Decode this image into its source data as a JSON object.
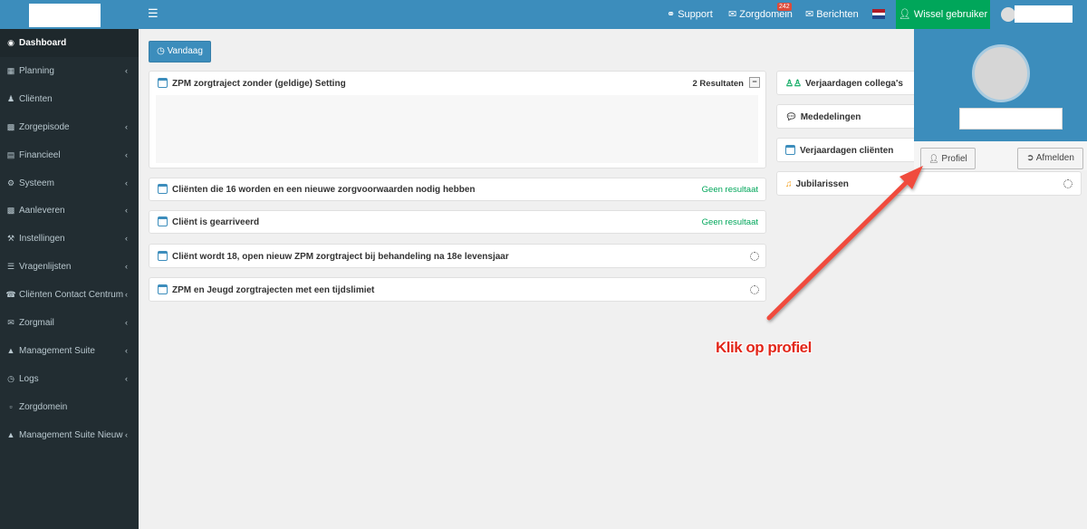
{
  "header": {
    "menu_icon": "hamburger-icon",
    "support": "Support",
    "zorgdomein": "Zorgdomein",
    "zorgdomein_badge": "242",
    "berichten": "Berichten",
    "switch_user": "Wissel gebruiker",
    "flag_colors": [
      "#ae1c28",
      "#ffffff",
      "#21468b"
    ],
    "accent": "#3c8dbc",
    "switch_color": "#00a65a"
  },
  "sidebar": {
    "items": [
      {
        "label": "Dashboard",
        "icon": "dashboard-icon",
        "chevron": false
      },
      {
        "label": "Planning",
        "icon": "calendar-icon",
        "chevron": true
      },
      {
        "label": "Cliënten",
        "icon": "user-icon",
        "chevron": false
      },
      {
        "label": "Zorgepisode",
        "icon": "medkit-icon",
        "chevron": true
      },
      {
        "label": "Financieel",
        "icon": "money-icon",
        "chevron": true
      },
      {
        "label": "Systeem",
        "icon": "cogs-icon",
        "chevron": true
      },
      {
        "label": "Aanleveren",
        "icon": "truck-icon",
        "chevron": true
      },
      {
        "label": "Instellingen",
        "icon": "wrench-icon",
        "chevron": true
      },
      {
        "label": "Vragenlijsten",
        "icon": "file-icon",
        "chevron": true
      },
      {
        "label": "Cliënten Contact Centrum",
        "icon": "phone-icon",
        "chevron": true
      },
      {
        "label": "Zorgmail",
        "icon": "envelope-icon",
        "chevron": true
      },
      {
        "label": "Management Suite",
        "icon": "chart-icon",
        "chevron": true
      },
      {
        "label": "Logs",
        "icon": "history-icon",
        "chevron": true
      },
      {
        "label": "Zorgdomein",
        "icon": "inbox-icon",
        "chevron": false
      },
      {
        "label": "Management Suite Nieuw",
        "icon": "chart-icon",
        "chevron": true
      }
    ]
  },
  "main": {
    "today_button": "Vandaag",
    "widgets_left": [
      {
        "title": "ZPM zorgtraject zonder (geldige) Setting",
        "meta": "2 Resultaten",
        "state": "results"
      },
      {
        "title": "Cliënten die 16 worden en een nieuwe zorgvoorwaarden nodig hebben",
        "meta": "Geen resultaat",
        "state": "none"
      },
      {
        "title": "Cliënt is gearriveerd",
        "meta": "Geen resultaat",
        "state": "none"
      },
      {
        "title": "Cliënt wordt 18, open nieuw ZPM zorgtraject bij behandeling na 18e levensjaar",
        "meta": "",
        "state": "loading"
      },
      {
        "title": "ZPM en Jeugd zorgtrajecten met een tijdslimiet",
        "meta": "",
        "state": "loading"
      }
    ],
    "widgets_right": [
      {
        "title": "Verjaardagen collega's",
        "icon": "users-icon"
      },
      {
        "title": "Mededelingen",
        "icon": "comments-icon"
      },
      {
        "title": "Verjaardagen cliënten",
        "icon": "calendar-icon"
      },
      {
        "title": "Jubilarissen",
        "icon": "cake-icon"
      }
    ]
  },
  "profile_dropdown": {
    "profile_button": "Profiel",
    "logout_button": "Afmelden"
  },
  "annotation": {
    "text": "Klik op profiel",
    "color": "#e2271a"
  }
}
